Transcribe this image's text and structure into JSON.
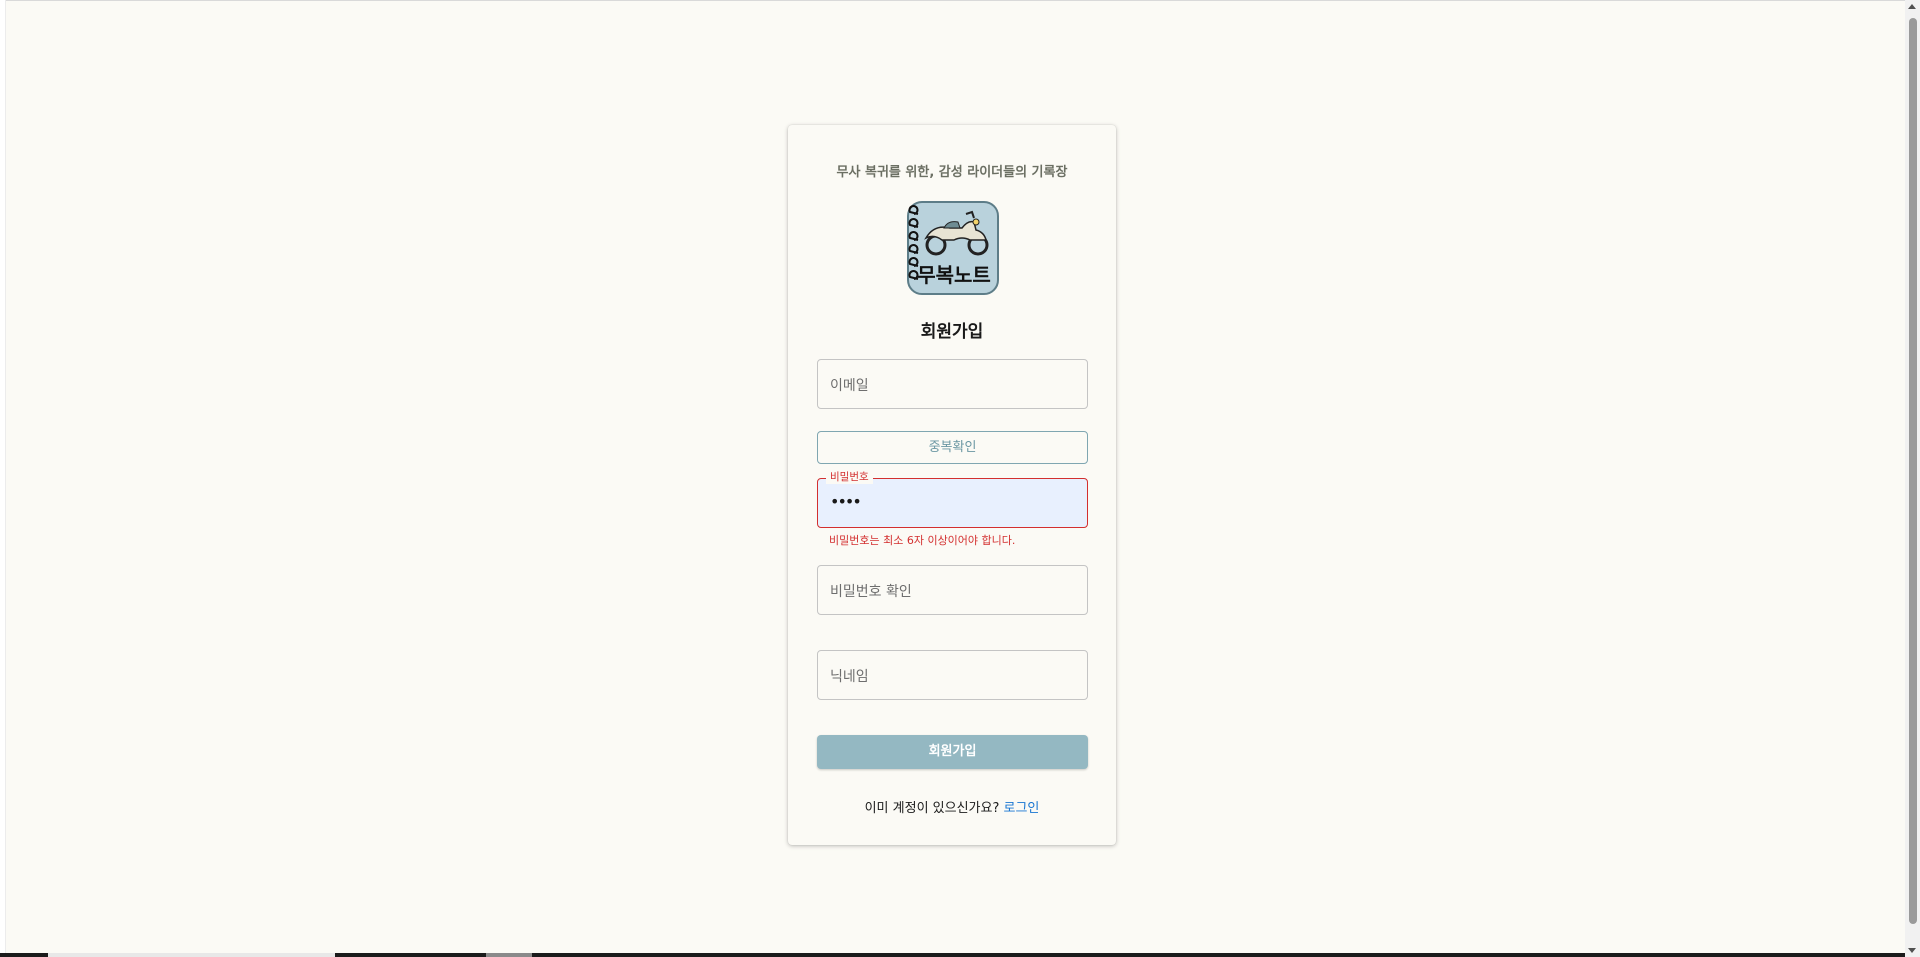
{
  "tagline": "무사 복귀를 위한, 감성 라이더들의 기록장",
  "logo": {
    "text": "무복노트",
    "colors": {
      "background": "#b9d2dc",
      "border": "#5d7d88"
    }
  },
  "heading": "회원가입",
  "form": {
    "email": {
      "placeholder": "이메일",
      "value": ""
    },
    "duplicate_check_label": "중복확인",
    "password": {
      "label": "비밀번호",
      "value": "••••",
      "error": "비밀번호는 최소 6자 이상이어야 합니다."
    },
    "password_confirm": {
      "placeholder": "비밀번호 확인",
      "value": ""
    },
    "nickname": {
      "placeholder": "닉네임",
      "value": ""
    },
    "submit_label": "회원가입"
  },
  "footer": {
    "prompt": "이미 계정이 있으신가요?",
    "login_link": "로그인"
  },
  "colors": {
    "page_background": "#fbfaf5",
    "accent": "#94b8c2",
    "error": "#d32f2f",
    "link": "#1976d2"
  }
}
